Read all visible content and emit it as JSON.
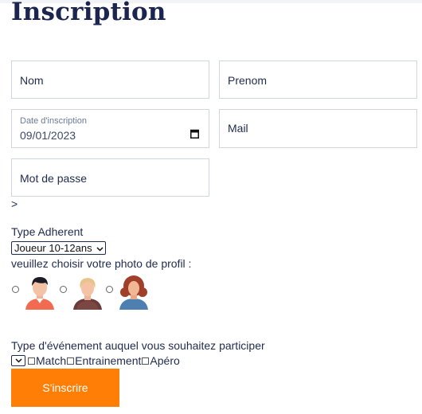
{
  "page": {
    "title": "Inscription"
  },
  "form": {
    "nom_placeholder": "Nom",
    "prenom_placeholder": "Prenom",
    "date_label": "Date d'inscription",
    "date_value": "09/01/2023",
    "mail_placeholder": "Mail",
    "password_placeholder": "Mot de passe",
    "stray_text": ">",
    "type_adherent_label": "Type Adherent",
    "type_adherent_selected": "Joueur 10-12ans",
    "photo_label": "veuillez choisir votre photo de profil :",
    "event_label": "Type d'événement auquel vous souhaitez participer",
    "events": [
      "Match",
      "Entrainement",
      "Apéro"
    ],
    "submit_label": "S'inscrire"
  },
  "icons": {
    "calendar": "calendar-icon",
    "chevron": "chevron-down-icon",
    "avatars": [
      "avatar-man-icon",
      "avatar-woman-blonde-icon",
      "avatar-woman-curly-icon"
    ]
  },
  "colors": {
    "title": "#1b2550",
    "text": "#1f2b4d",
    "border": "#cfd6e0",
    "button": "#ff7f06"
  }
}
